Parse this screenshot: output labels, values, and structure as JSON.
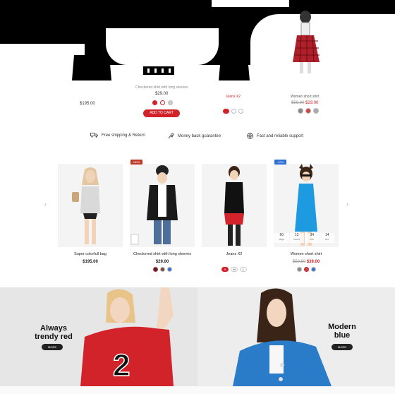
{
  "top_row": {
    "product_name_center": "Checkered shirt with long sleeves",
    "product_price_center": "$29.00",
    "product_price_left": "$195.00",
    "product_name_right": "Jeans X2",
    "product_name_far_right": "Women short shirt",
    "price_far_right_old": "$59.90",
    "price_far_right_new": "$29.00",
    "add_to_cart_label": "ADD TO CART"
  },
  "features": [
    {
      "icon": "truck-icon",
      "label": "Free shipping & Return"
    },
    {
      "icon": "money-icon",
      "label": "Money back guarantee"
    },
    {
      "icon": "support-icon",
      "label": "Fast and reliable support"
    }
  ],
  "products": [
    {
      "name": "Super colorfull bag",
      "price": "$195.00",
      "badge": "",
      "swatches": []
    },
    {
      "name": "Checkered shirt with long sleeves",
      "price": "$29.00",
      "badge": "NEW",
      "swatches": [
        "#333333",
        "#7a4a3a",
        "#3a6fd8"
      ]
    },
    {
      "name": "Jeans X2",
      "price": "",
      "badge": "",
      "sizes": [
        "S",
        "M",
        "L"
      ]
    },
    {
      "name": "Women short shirt",
      "price_old": "$59.90",
      "price_new": "$39.00",
      "badge": "-10%",
      "swatches": [
        "#888888",
        "#c44",
        "#3a6fd8"
      ]
    }
  ],
  "countdown": [
    {
      "value": "60",
      "unit": "days"
    },
    {
      "value": "12",
      "unit": "hours"
    },
    {
      "value": "34",
      "unit": "min"
    },
    {
      "value": "14",
      "unit": "sec"
    }
  ],
  "banners": {
    "left": {
      "title_line1": "Always",
      "title_line2": "trendy red",
      "button": "MORE"
    },
    "right": {
      "title_line1": "Modern",
      "title_line2": "blue",
      "button": "MORE"
    }
  },
  "colors": {
    "accent_red": "#d2232a",
    "badge_blue": "#2f6fd8",
    "badge_red": "#c0392b"
  }
}
